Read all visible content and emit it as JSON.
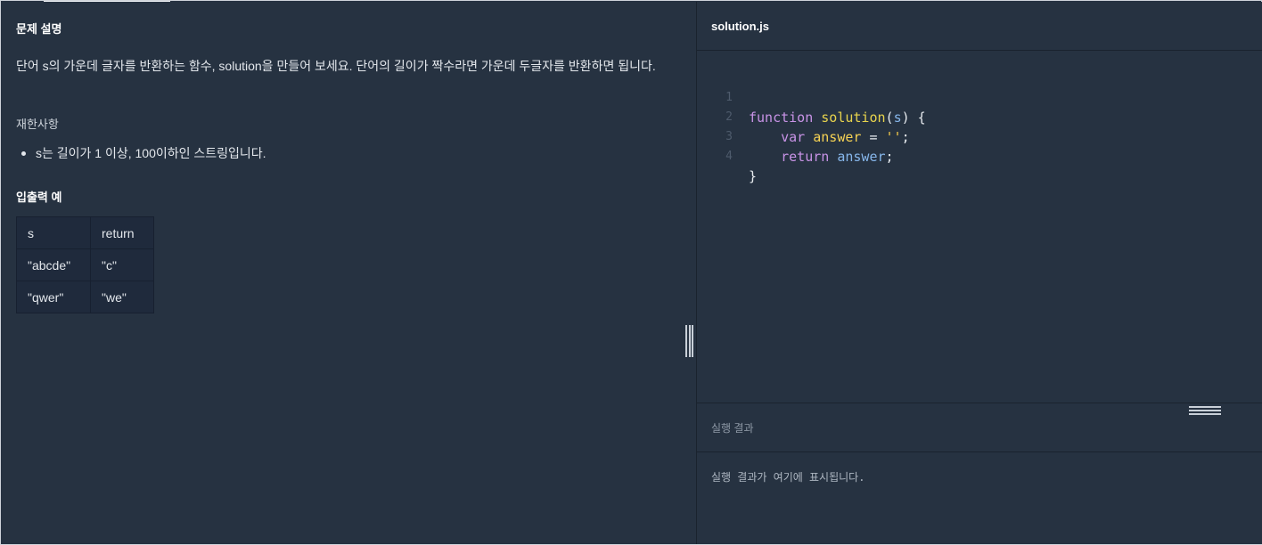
{
  "problem": {
    "title": "문제 설명",
    "description": "단어 s의 가운데 글자를 반환하는 함수, solution을 만들어 보세요. 단어의 길이가 짝수라면 가운데 두글자를 반환하면 됩니다.",
    "constraints_title": "재한사항",
    "constraints": [
      "s는 길이가 1 이상, 100이하인 스트링입니다."
    ],
    "io_title": "입출력 예",
    "io_table": {
      "headers": [
        "s",
        "return"
      ],
      "rows": [
        [
          "\"abcde\"",
          "\"c\""
        ],
        [
          "\"qwer\"",
          "\"we\""
        ]
      ]
    }
  },
  "editor": {
    "filename": "solution.js",
    "line_numbers": [
      "1",
      "2",
      "3",
      "4"
    ],
    "tokens": {
      "l1_kw": "function",
      "l1_fn": "solution",
      "l1_open": "(",
      "l1_param": "s",
      "l1_close": ") {",
      "l2_kw": "var",
      "l2_var": "answer",
      "l2_eq": " = ",
      "l2_str": "''",
      "l2_semi": ";",
      "l3_kw": "return",
      "l3_var": "answer",
      "l3_semi": ";",
      "l4": "}"
    }
  },
  "results": {
    "title": "실행 결과",
    "placeholder": "실행 결과가 여기에 표시됩니다."
  }
}
